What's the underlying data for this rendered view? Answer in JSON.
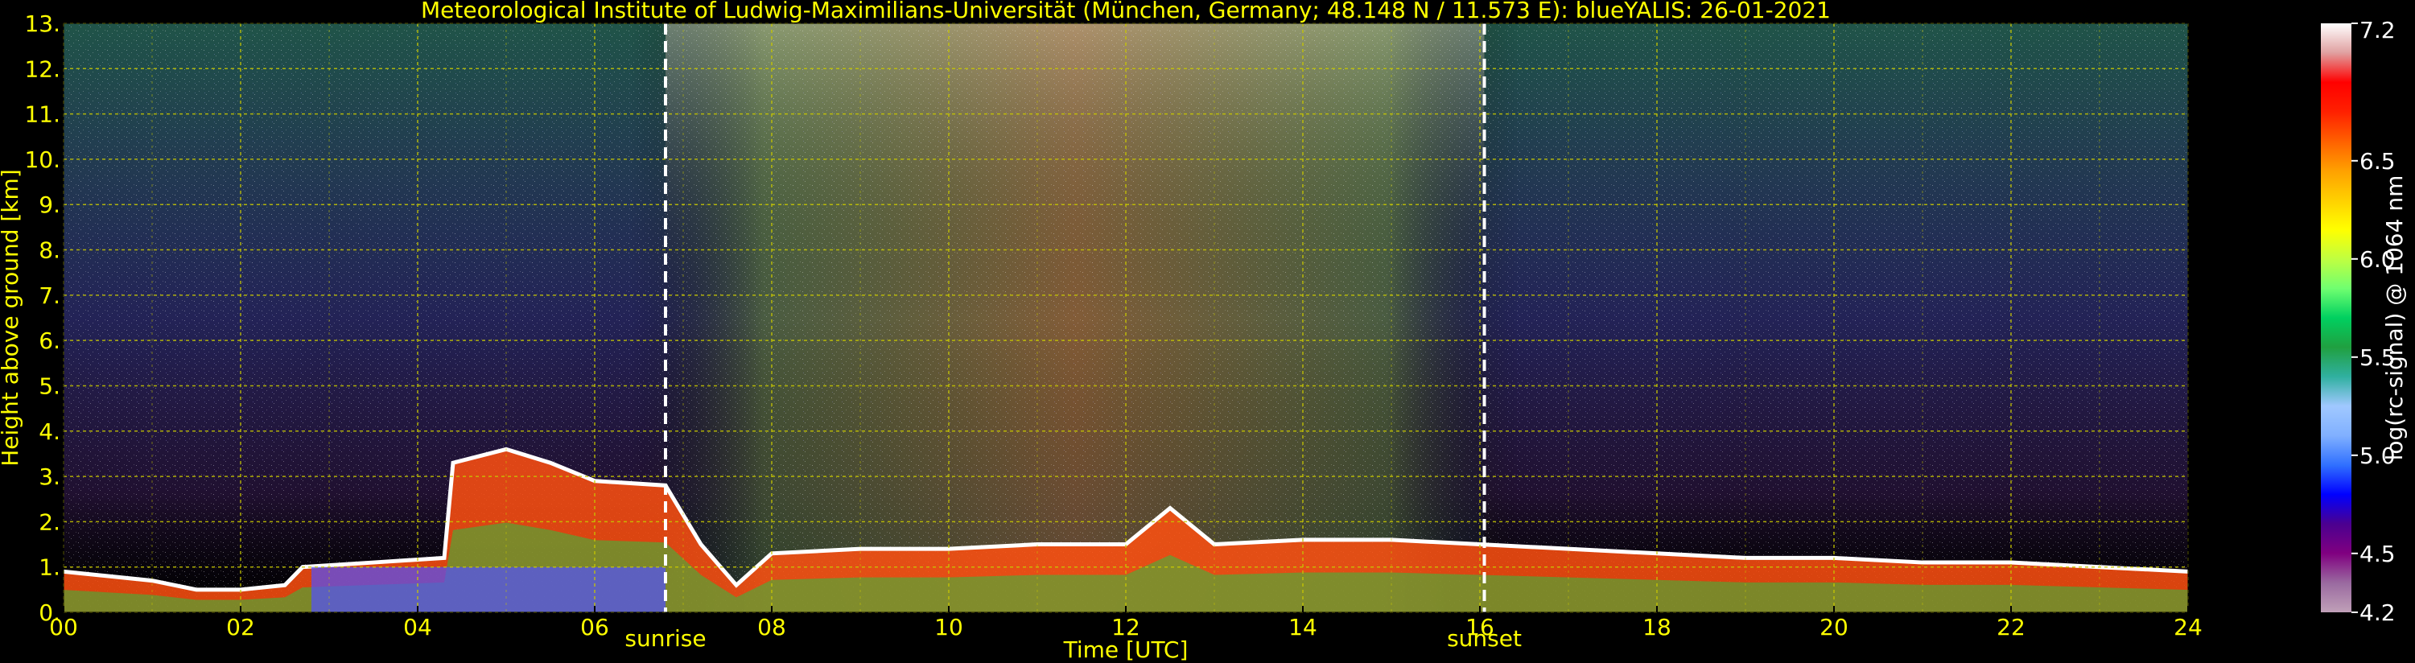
{
  "chart_data": {
    "type": "heatmap",
    "title": "Meteorological Institute of Ludwig-Maximilians-Universität (München, Germany; 48.148 N / 11.573 E):     blueYALIS: 26-01-2021",
    "xlabel": "Time [UTC]",
    "ylabel": "Height above ground [km]",
    "xlim": [
      0,
      24
    ],
    "ylim": [
      0,
      13
    ],
    "x_ticks": [
      0,
      2,
      4,
      6,
      8,
      10,
      12,
      14,
      16,
      18,
      20,
      22,
      24
    ],
    "x_tick_labels": [
      "00",
      "02",
      "04",
      "06",
      "08",
      "10",
      "12",
      "14",
      "16",
      "18",
      "20",
      "22",
      "24"
    ],
    "y_ticks": [
      0,
      1,
      2,
      3,
      4,
      5,
      6,
      7,
      8,
      9,
      10,
      11,
      12,
      13
    ],
    "y_tick_labels": [
      "0.",
      "1.",
      "2.",
      "3.",
      "4.",
      "5.",
      "6.",
      "7.",
      "8.",
      "9.",
      "10.",
      "11.",
      "12.",
      "13."
    ],
    "grid": true,
    "colorbar": {
      "label": "log(rc-signal) @ 1064 nm",
      "range": [
        4.2,
        7.2
      ],
      "ticks": [
        4.2,
        4.5,
        5.0,
        5.5,
        6.0,
        6.5,
        7.2
      ],
      "tick_labels": [
        "4.2",
        "4.5",
        "5.0",
        "5.5",
        "6.0",
        "6.5",
        "7.2"
      ]
    },
    "annotations": [
      {
        "label": "sunrise",
        "x": 6.8
      },
      {
        "label": "sunset",
        "x": 16.05
      }
    ],
    "boundary_layer_top_km": [
      [
        0.0,
        0.9
      ],
      [
        1.0,
        0.7
      ],
      [
        1.5,
        0.5
      ],
      [
        2.0,
        0.5
      ],
      [
        2.5,
        0.6
      ],
      [
        2.7,
        1.0
      ],
      [
        3.5,
        1.1
      ],
      [
        4.3,
        1.2
      ],
      [
        4.4,
        3.3
      ],
      [
        5.0,
        3.6
      ],
      [
        5.5,
        3.3
      ],
      [
        6.0,
        2.9
      ],
      [
        6.8,
        2.8
      ],
      [
        7.2,
        1.5
      ],
      [
        7.6,
        0.6
      ],
      [
        8.0,
        1.3
      ],
      [
        9.0,
        1.4
      ],
      [
        10.0,
        1.4
      ],
      [
        11.0,
        1.5
      ],
      [
        12.0,
        1.5
      ],
      [
        12.5,
        2.3
      ],
      [
        13.0,
        1.5
      ],
      [
        14.0,
        1.6
      ],
      [
        15.0,
        1.6
      ],
      [
        16.0,
        1.5
      ],
      [
        17.0,
        1.4
      ],
      [
        18.0,
        1.3
      ],
      [
        19.0,
        1.2
      ],
      [
        20.0,
        1.2
      ],
      [
        21.0,
        1.1
      ],
      [
        22.0,
        1.1
      ],
      [
        23.0,
        1.0
      ],
      [
        24.0,
        0.9
      ]
    ]
  },
  "colors": {
    "text": "#ffff00",
    "grid": "#c8c800",
    "daylight_marker": "#ffffff",
    "colorbar_stops": [
      "#c0a0b8",
      "#9a6aa0",
      "#800080",
      "#4b0090",
      "#0000ff",
      "#3070ff",
      "#80b0ff",
      "#a0c8ff",
      "#30b0a0",
      "#20a040",
      "#00d060",
      "#70ff70",
      "#c0ff40",
      "#ffff00",
      "#ffd000",
      "#ffa000",
      "#ff6000",
      "#ff2000",
      "#ff0000",
      "#e0a0a0",
      "#ffffff"
    ]
  }
}
